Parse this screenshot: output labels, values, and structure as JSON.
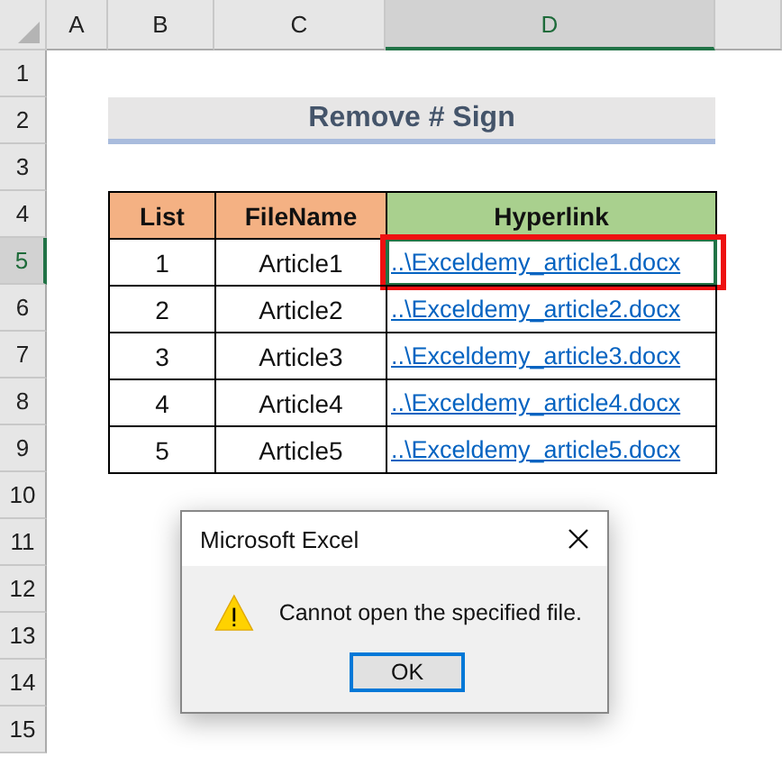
{
  "columns": [
    {
      "label": "A",
      "selected": false
    },
    {
      "label": "B",
      "selected": false
    },
    {
      "label": "C",
      "selected": false
    },
    {
      "label": "D",
      "selected": true
    }
  ],
  "rows": [
    {
      "label": "1",
      "selected": false
    },
    {
      "label": "2",
      "selected": false
    },
    {
      "label": "3",
      "selected": false
    },
    {
      "label": "4",
      "selected": false
    },
    {
      "label": "5",
      "selected": true
    },
    {
      "label": "6",
      "selected": false
    },
    {
      "label": "7",
      "selected": false
    },
    {
      "label": "8",
      "selected": false
    },
    {
      "label": "9",
      "selected": false
    },
    {
      "label": "10",
      "selected": false
    },
    {
      "label": "11",
      "selected": false
    },
    {
      "label": "12",
      "selected": false
    },
    {
      "label": "13",
      "selected": false
    },
    {
      "label": "14",
      "selected": false
    },
    {
      "label": "15",
      "selected": false
    }
  ],
  "title": "Remove # Sign",
  "table": {
    "columns": [
      {
        "label": "List",
        "color": "#f4b183"
      },
      {
        "label": "FileName",
        "color": "#f4b183"
      },
      {
        "label": "Hyperlink",
        "color": "#a9d08e"
      }
    ],
    "rows": [
      {
        "list": "1",
        "file_name": "Article1",
        "hyperlink": "..\\Exceldemy_article1.docx",
        "selected": true
      },
      {
        "list": "2",
        "file_name": "Article2",
        "hyperlink": "..\\Exceldemy_article2.docx",
        "selected": false
      },
      {
        "list": "3",
        "file_name": "Article3",
        "hyperlink": "..\\Exceldemy_article3.docx",
        "selected": false
      },
      {
        "list": "4",
        "file_name": "Article4",
        "hyperlink": "..\\Exceldemy_article4.docx",
        "selected": false
      },
      {
        "list": "5",
        "file_name": "Article5",
        "hyperlink": "..\\Exceldemy_article5.docx",
        "selected": false
      }
    ]
  },
  "dialog": {
    "title": "Microsoft Excel",
    "message": "Cannot open the specified file.",
    "buttons": [
      "OK"
    ]
  }
}
